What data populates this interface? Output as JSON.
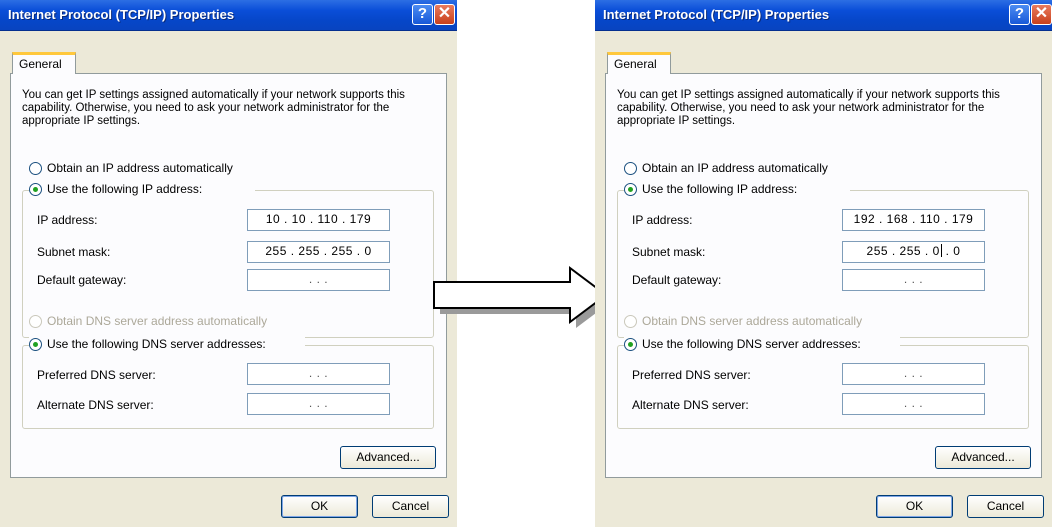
{
  "dialogs": [
    {
      "title": "Internet Protocol (TCP/IP) Properties",
      "tab": "General",
      "description": "You can get IP settings assigned automatically if your network supports this capability. Otherwise, you need to ask your network administrator for the appropriate IP settings.",
      "obtain_ip_auto": "Obtain an IP address automatically",
      "use_following_ip": "Use the following IP address:",
      "ip_address_label": "IP address:",
      "ip_address": "10 . 10 . 110 . 179",
      "subnet_mask_label": "Subnet mask:",
      "subnet_mask": "255 . 255 . 255 . 0",
      "default_gateway_label": "Default gateway:",
      "default_gateway": ". . .",
      "obtain_dns_auto": "Obtain DNS server address automatically",
      "use_following_dns": "Use the following DNS server addresses:",
      "preferred_dns_label": "Preferred DNS server:",
      "preferred_dns": ". . .",
      "alternate_dns_label": "Alternate DNS server:",
      "alternate_dns": ". . .",
      "advanced_button": "Advanced...",
      "ok_button": "OK",
      "cancel_button": "Cancel"
    },
    {
      "title": "Internet Protocol (TCP/IP) Properties",
      "tab": "General",
      "description": "You can get IP settings assigned automatically if your network supports this capability. Otherwise, you need to ask your network administrator for the appropriate IP settings.",
      "obtain_ip_auto": "Obtain an IP address automatically",
      "use_following_ip": "Use the following IP address:",
      "ip_address_label": "IP address:",
      "ip_address": "192 . 168 . 110 . 179",
      "subnet_mask_label": "Subnet mask:",
      "subnet_mask_a": "255 . 255 . 0",
      "subnet_mask_b": " . 0",
      "default_gateway_label": "Default gateway:",
      "default_gateway": ". . .",
      "obtain_dns_auto": "Obtain DNS server address automatically",
      "use_following_dns": "Use the following DNS server addresses:",
      "preferred_dns_label": "Preferred DNS server:",
      "preferred_dns": ". . .",
      "alternate_dns_label": "Alternate DNS server:",
      "alternate_dns": ". . .",
      "advanced_button": "Advanced...",
      "ok_button": "OK",
      "cancel_button": "Cancel"
    }
  ],
  "colors": {
    "titlebar": "#0a4ed8",
    "dialog_bg": "#ece9d8",
    "panel_bg": "#fcfcfe",
    "radio_dot": "#21a121",
    "tab_highlight": "#ffc83c"
  },
  "icons": [
    "help-icon",
    "close-icon",
    "right-arrow-icon"
  ]
}
